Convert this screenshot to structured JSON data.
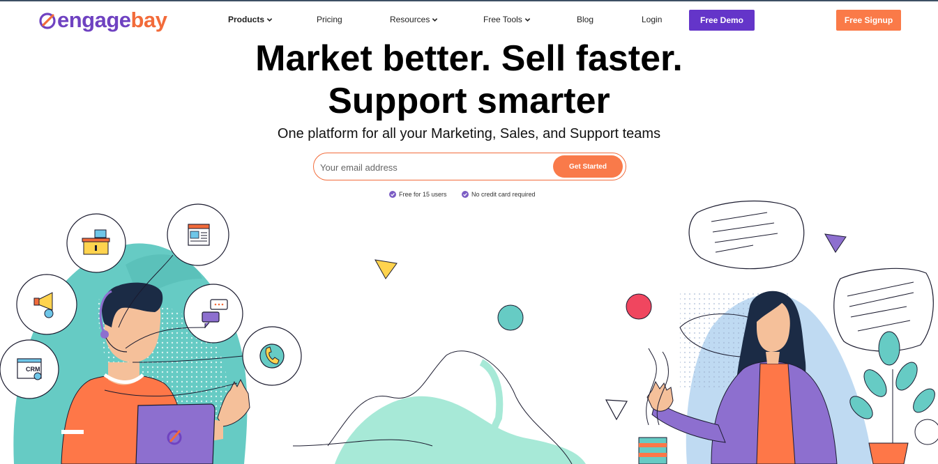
{
  "brand": {
    "logo_text_1": "engage",
    "logo_text_2": "bay",
    "primary_color": "#6435c9",
    "accent_color": "#fa7a48"
  },
  "nav": {
    "products": "Products",
    "pricing": "Pricing",
    "resources": "Resources",
    "free_tools": "Free Tools",
    "blog": "Blog",
    "login": "Login",
    "free_demo": "Free Demo",
    "free_signup": "Free Signup"
  },
  "hero": {
    "headline_line1": "Market better. Sell faster.",
    "headline_line2": "Support smarter",
    "subheading": "One platform for all your Marketing, Sales, and Support teams",
    "email_placeholder": "Your email address",
    "email_value": "",
    "cta_label": "Get Started",
    "perks": [
      "Free for 15 users",
      "No credit card required"
    ]
  },
  "illustration": {
    "crm_badge": "CRM",
    "icons": [
      "desk-icon",
      "webpage-icon",
      "megaphone-icon",
      "chat-icon",
      "crm-icon",
      "phone-icon",
      "speech-bubble-icon"
    ]
  }
}
